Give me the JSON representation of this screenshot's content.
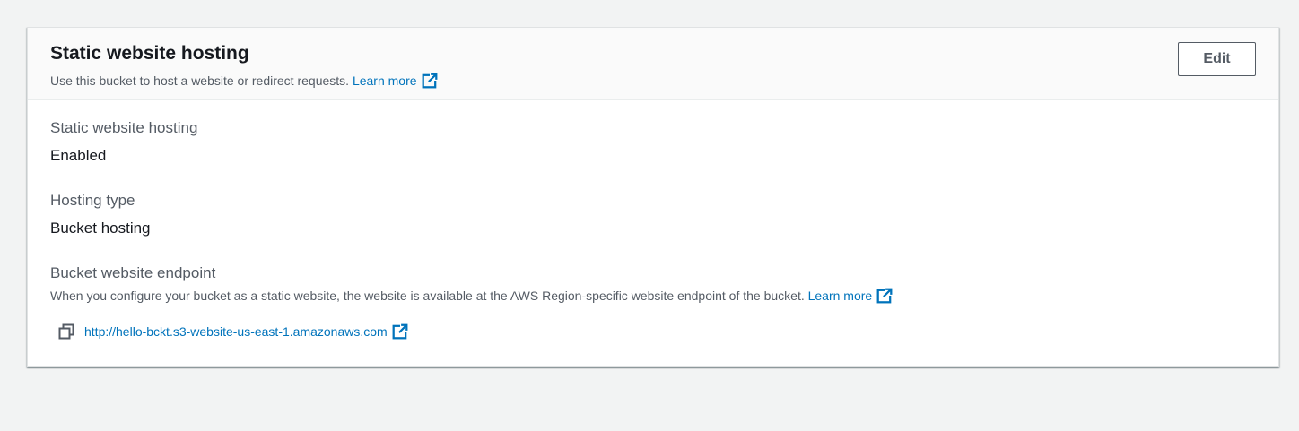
{
  "panel": {
    "title": "Static website hosting",
    "description": "Use this bucket to host a website or redirect requests.",
    "learn_more": "Learn more",
    "edit_label": "Edit"
  },
  "fields": {
    "hosting": {
      "label": "Static website hosting",
      "value": "Enabled"
    },
    "hosting_type": {
      "label": "Hosting type",
      "value": "Bucket hosting"
    },
    "endpoint": {
      "label": "Bucket website endpoint",
      "description": "When you configure your bucket as a static website, the website is available at the AWS Region-specific website endpoint of the bucket.",
      "learn_more": "Learn more",
      "url": "http://hello-bckt.s3-website-us-east-1.amazonaws.com"
    }
  },
  "icons": {
    "external_link": "external-link-icon",
    "copy": "copy-icon"
  },
  "colors": {
    "link": "#0073bb",
    "background": "#f2f3f3",
    "header_bg": "#fafafa",
    "text_primary": "#16191f",
    "text_secondary": "#545b64"
  }
}
